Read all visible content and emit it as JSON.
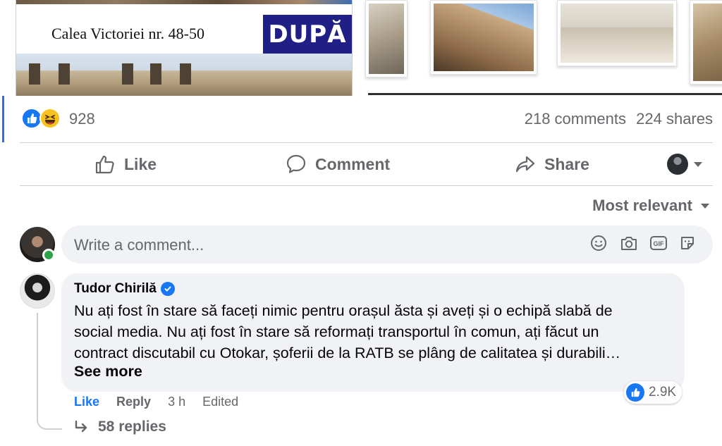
{
  "post": {
    "image_caption": "Calea Victoriei nr. 48-50",
    "image_badge": "DUPĂ"
  },
  "stats": {
    "reaction_count": "928",
    "comments": "218 comments",
    "shares": "224 shares"
  },
  "actions": {
    "like": "Like",
    "comment": "Comment",
    "share": "Share"
  },
  "sort": {
    "label": "Most relevant"
  },
  "composer": {
    "placeholder": "Write a comment...",
    "icons": [
      "emoji-icon",
      "camera-icon",
      "gif-icon",
      "sticker-icon"
    ]
  },
  "comment": {
    "author": "Tudor Chirilă",
    "verified": true,
    "text": "Nu ați fost în stare să faceți nimic pentru orașul ăsta și aveți și o echipă slabă de\nsocial media. Nu ați fost în stare să reformați transportul în comun, ați făcut un\ncontract discutabil cu Otokar, șoferii de la RATB se plâng de calitatea și durabili…",
    "see_more": "See more",
    "reactions": "2.9K",
    "like": "Like",
    "reply": "Reply",
    "time": "3 h",
    "edited": "Edited",
    "replies": "58 replies"
  },
  "colors": {
    "accent": "#1877f2",
    "muted_text": "#65676b",
    "bubble_bg": "#f0f2f5",
    "online": "#31a24c"
  }
}
